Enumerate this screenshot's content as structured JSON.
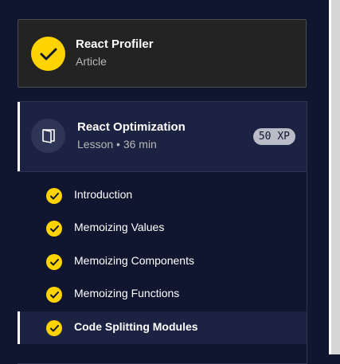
{
  "completed_item": {
    "title": "React Profiler",
    "type": "Article",
    "icon": "check-icon",
    "status_color": "#ffd300"
  },
  "current_lesson": {
    "title": "React Optimization",
    "meta": "Lesson • 36 min",
    "xp": "50 XP",
    "icon": "book-icon",
    "items": [
      {
        "label": "Introduction",
        "completed": true,
        "active": false
      },
      {
        "label": "Memoizing Values",
        "completed": true,
        "active": false
      },
      {
        "label": "Memoizing Components",
        "completed": true,
        "active": false
      },
      {
        "label": "Memoizing Functions",
        "completed": true,
        "active": false
      },
      {
        "label": "Code Splitting Modules",
        "completed": true,
        "active": true
      }
    ]
  },
  "colors": {
    "background": "#10162f",
    "panel": "#1c2241",
    "accent": "#ffd300",
    "card": "#232323"
  }
}
